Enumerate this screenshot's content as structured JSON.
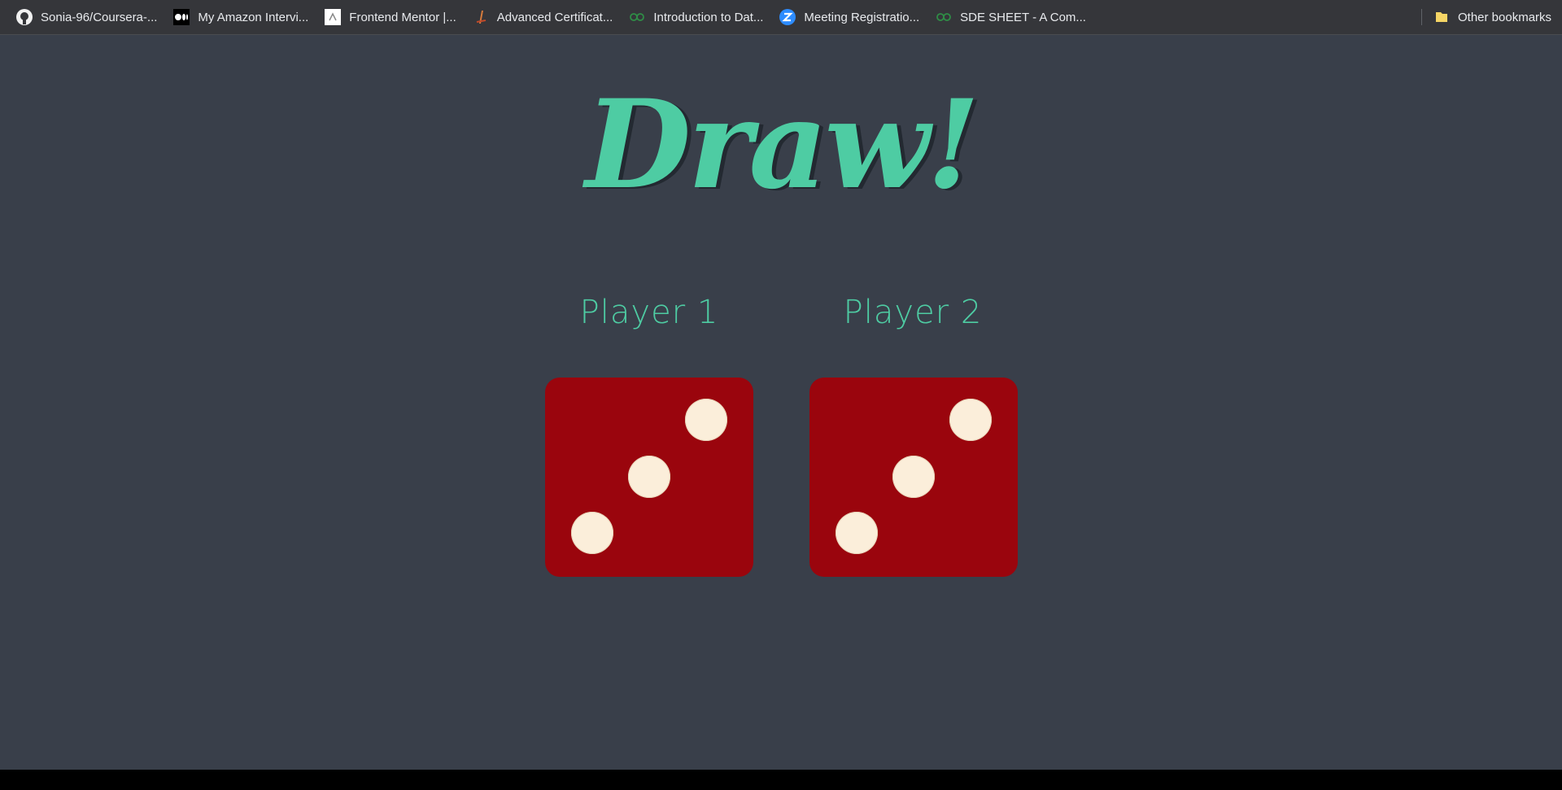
{
  "bookmarks": [
    {
      "label": "Sonia-96/Coursera-...",
      "icon": "github-icon"
    },
    {
      "label": "My Amazon Intervi...",
      "icon": "medium-icon"
    },
    {
      "label": "Frontend Mentor |...",
      "icon": "frontend-mentor-icon"
    },
    {
      "label": "Advanced Certificat...",
      "icon": "certificate-icon"
    },
    {
      "label": "Introduction to Dat...",
      "icon": "geeksforgeeks-icon"
    },
    {
      "label": "Meeting Registratio...",
      "icon": "zoom-icon"
    },
    {
      "label": "SDE SHEET - A Com...",
      "icon": "geeksforgeeks-icon"
    }
  ],
  "other_bookmarks": {
    "label": "Other bookmarks",
    "icon": "folder-icon"
  },
  "game": {
    "title": "Draw!",
    "player1": {
      "label": "Player 1",
      "die_value": 3
    },
    "player2": {
      "label": "Player 2",
      "die_value": 3
    }
  },
  "colors": {
    "page_background": "#393f4a",
    "accent": "#4ecca3",
    "die": "#9a050d",
    "pip": "#fbeeda"
  }
}
